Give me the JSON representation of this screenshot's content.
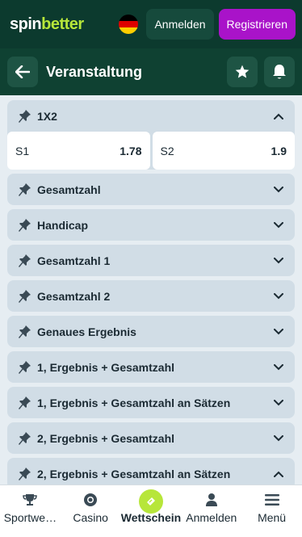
{
  "header": {
    "logo_part1": "spin",
    "logo_part2": "better",
    "login_label": "Anmelden",
    "register_label": "Registrieren"
  },
  "event": {
    "title": "Veranstaltung"
  },
  "markets": [
    {
      "name": "1X2",
      "expanded": true,
      "odds": [
        {
          "label": "S1",
          "value": "1.78"
        },
        {
          "label": "S2",
          "value": "1.9"
        }
      ]
    },
    {
      "name": "Gesamtzahl",
      "expanded": false
    },
    {
      "name": "Handicap",
      "expanded": false
    },
    {
      "name": "Gesamtzahl 1",
      "expanded": false
    },
    {
      "name": "Gesamtzahl 2",
      "expanded": false
    },
    {
      "name": "Genaues Ergebnis",
      "expanded": false
    },
    {
      "name": "1, Ergebnis + Gesamtzahl",
      "expanded": false
    },
    {
      "name": "1, Ergebnis + Gesamtzahl an Sätzen",
      "expanded": false
    },
    {
      "name": "2, Ergebnis + Gesamtzahl",
      "expanded": false
    },
    {
      "name": "2, Ergebnis + Gesamtzahl an Sätzen",
      "expanded": true
    }
  ],
  "bottom_nav": [
    {
      "label": "Sportwe…",
      "icon": "trophy-icon"
    },
    {
      "label": "Casino",
      "icon": "casino-chip-icon"
    },
    {
      "label": "Wettschein",
      "icon": "ticket-icon",
      "active": true
    },
    {
      "label": "Anmelden",
      "icon": "user-icon"
    },
    {
      "label": "Menü",
      "icon": "menu-icon"
    }
  ],
  "colors": {
    "topbar": "#0c3a2e",
    "eventbar": "#0f4132",
    "brand_green": "#b7e63a",
    "register_purple": "#a913c9",
    "market_bg": "#d1dde6"
  }
}
